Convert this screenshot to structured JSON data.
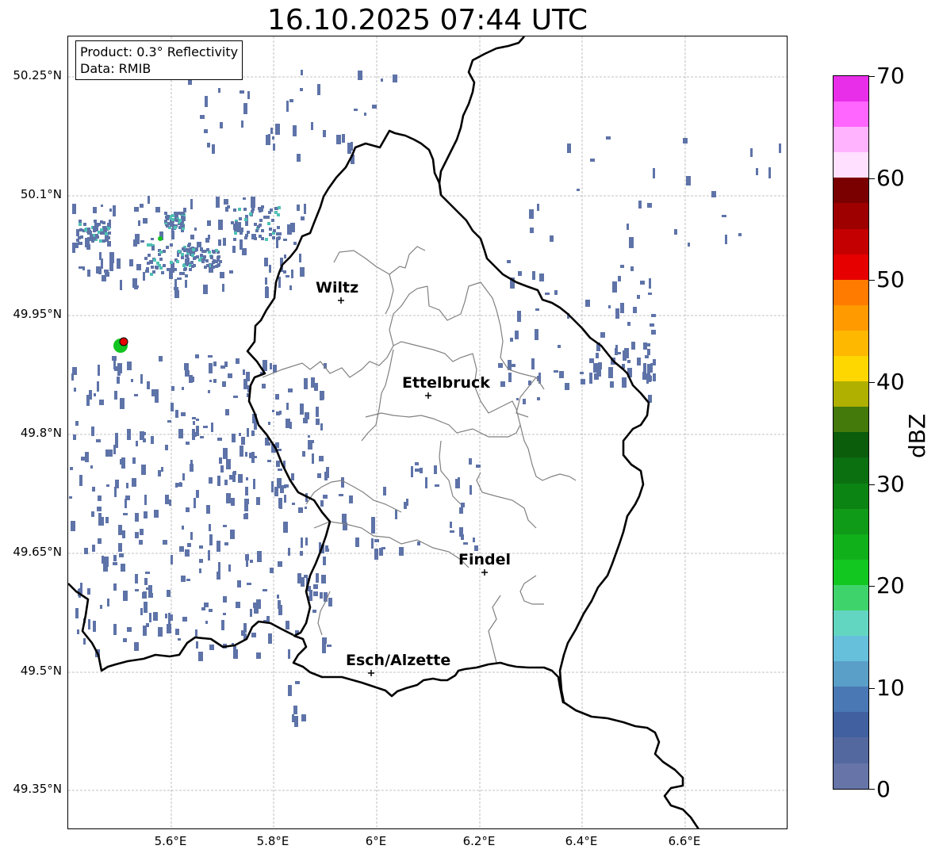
{
  "title": "16.10.2025 07:44 UTC",
  "info_box": {
    "product": "Product: 0.3° Reflectivity",
    "data": "Data: RMIB"
  },
  "y_ticks": [
    "50.25°N",
    "50.1°N",
    "49.95°N",
    "49.8°N",
    "49.65°N",
    "49.5°N",
    "49.35°N"
  ],
  "x_ticks": [
    "5.6°E",
    "5.8°E",
    "6°E",
    "6.2°E",
    "6.4°E",
    "6.6°E"
  ],
  "cities": [
    {
      "name": "Wiltz"
    },
    {
      "name": "Ettelbruck"
    },
    {
      "name": "Findel"
    },
    {
      "name": "Esch/Alzette"
    }
  ],
  "colorbar": {
    "label": "dBZ",
    "ticks": [
      "70",
      "60",
      "50",
      "40",
      "30",
      "20",
      "10",
      "0"
    ],
    "colors": [
      "#e92ee9",
      "#ff66ff",
      "#ffb3ff",
      "#ffe0ff",
      "#7a0000",
      "#9e0000",
      "#c40000",
      "#e60000",
      "#ff7b00",
      "#ff9a00",
      "#ffb800",
      "#ffd700",
      "#b0b000",
      "#437a0b",
      "#0b5c0b",
      "#0a7010",
      "#0c8414",
      "#0f9a18",
      "#10b01b",
      "#12c820",
      "#3fd46b",
      "#63d6c1",
      "#66c0dc",
      "#5a9fc8",
      "#4a78b4",
      "#4160a0",
      "#5468a0",
      "#6674a8"
    ]
  },
  "colors": {
    "echo_low": "#5e73a8",
    "echo_mid": "#4fc2b3",
    "echo_green": "#12c420",
    "echo_red": "#e60000",
    "border": "#000000",
    "canton_border": "#808080",
    "grid": "#b0b0b0"
  }
}
